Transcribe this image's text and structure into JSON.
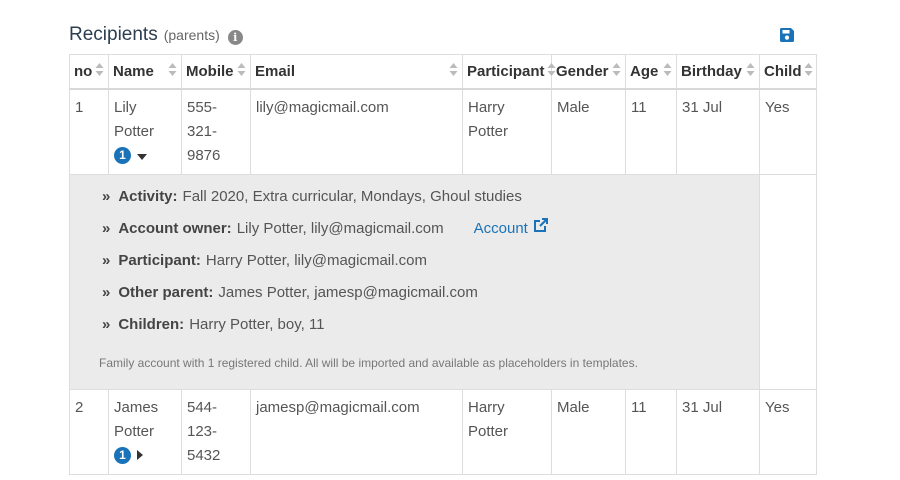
{
  "header": {
    "title": "Recipients",
    "subtitle": "(parents)"
  },
  "columns": [
    "no",
    "Name",
    "Mobile",
    "Email",
    "Participant",
    "Gender",
    "Age",
    "Birthday",
    "Child"
  ],
  "rows": [
    {
      "no": "1",
      "name": "Lily Potter",
      "badge": "1",
      "mobile": "555-321-9876",
      "email": "lily@magicmail.com",
      "participant": "Harry Potter",
      "gender": "Male",
      "age": "11",
      "birthday": "31 Jul",
      "child": "Yes",
      "expanded": true
    },
    {
      "no": "2",
      "name": "James Potter",
      "badge": "1",
      "mobile": "544-123-5432",
      "email": "jamesp@magicmail.com",
      "participant": "Harry Potter",
      "gender": "Male",
      "age": "11",
      "birthday": "31 Jul",
      "child": "Yes",
      "expanded": false
    }
  ],
  "details": {
    "activity_label": "Activity:",
    "activity_value": "Fall 2020, Extra curricular, Mondays, Ghoul studies",
    "owner_label": "Account owner:",
    "owner_value": "Lily Potter, lily@magicmail.com",
    "account_link": "Account",
    "participant_label": "Participant:",
    "participant_value": "Harry Potter, lily@magicmail.com",
    "other_parent_label": "Other parent:",
    "other_parent_value": "James Potter, jamesp@magicmail.com",
    "children_label": "Children:",
    "children_value": "Harry Potter, boy, 11",
    "note": "Family account with 1 registered child. All will be imported and available as placeholders in templates."
  },
  "colors": {
    "accent": "#1a73b8",
    "detail_bg": "#ebebeb",
    "border": "#dddddd"
  },
  "icons": {
    "info": "info-icon",
    "save": "floppy-disk-icon",
    "sort": "sort-icon",
    "expand": "caret-down-icon",
    "collapse": "caret-right-icon",
    "external": "external-link-icon",
    "bullet": "double-chevron-right-icon"
  }
}
